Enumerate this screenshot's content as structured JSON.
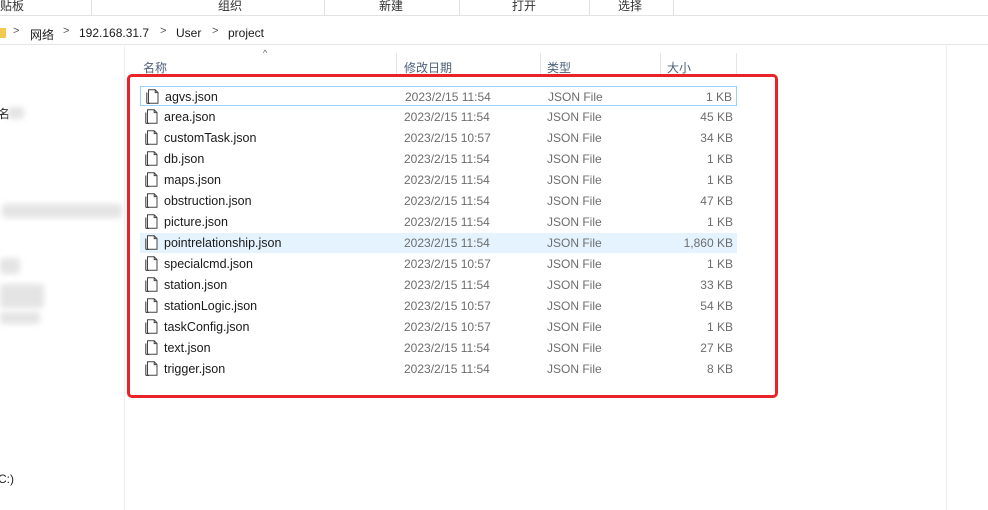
{
  "ribbon": {
    "groups": [
      "贴板",
      "组织",
      "新建",
      "打开",
      "选择"
    ]
  },
  "address": {
    "crumbs": [
      "网络",
      "192.168.31.7",
      "User",
      "project"
    ],
    "separator": ">"
  },
  "nav": {
    "items": [
      "名",
      "C:)"
    ]
  },
  "columns": {
    "name": "名称",
    "modified": "修改日期",
    "type": "类型",
    "size": "大小"
  },
  "files": [
    {
      "name": "agvs.json",
      "modified": "2023/2/15 11:54",
      "type": "JSON File",
      "size": "1 KB"
    },
    {
      "name": "area.json",
      "modified": "2023/2/15 11:54",
      "type": "JSON File",
      "size": "45 KB"
    },
    {
      "name": "customTask.json",
      "modified": "2023/2/15 10:57",
      "type": "JSON File",
      "size": "34 KB"
    },
    {
      "name": "db.json",
      "modified": "2023/2/15 11:54",
      "type": "JSON File",
      "size": "1 KB"
    },
    {
      "name": "maps.json",
      "modified": "2023/2/15 11:54",
      "type": "JSON File",
      "size": "1 KB"
    },
    {
      "name": "obstruction.json",
      "modified": "2023/2/15 11:54",
      "type": "JSON File",
      "size": "47 KB"
    },
    {
      "name": "picture.json",
      "modified": "2023/2/15 11:54",
      "type": "JSON File",
      "size": "1 KB"
    },
    {
      "name": "pointrelationship.json",
      "modified": "2023/2/15 11:54",
      "type": "JSON File",
      "size": "1,860 KB"
    },
    {
      "name": "specialcmd.json",
      "modified": "2023/2/15 10:57",
      "type": "JSON File",
      "size": "1 KB"
    },
    {
      "name": "station.json",
      "modified": "2023/2/15 11:54",
      "type": "JSON File",
      "size": "33 KB"
    },
    {
      "name": "stationLogic.json",
      "modified": "2023/2/15 10:57",
      "type": "JSON File",
      "size": "54 KB"
    },
    {
      "name": "taskConfig.json",
      "modified": "2023/2/15 10:57",
      "type": "JSON File",
      "size": "1 KB"
    },
    {
      "name": "text.json",
      "modified": "2023/2/15 11:54",
      "type": "JSON File",
      "size": "27 KB"
    },
    {
      "name": "trigger.json",
      "modified": "2023/2/15 11:54",
      "type": "JSON File",
      "size": "8 KB"
    }
  ],
  "colors": {
    "selected_border": "#99d1ff",
    "hover_bg": "#e5f3ff",
    "annotation_red": "#e8232a",
    "header_text": "#4c607a"
  }
}
